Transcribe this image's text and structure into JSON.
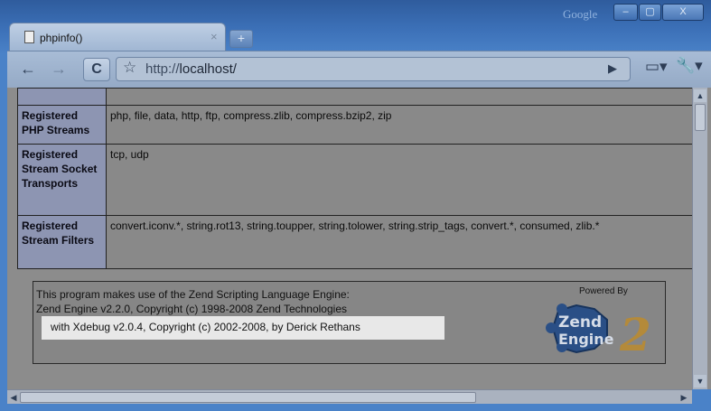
{
  "window": {
    "brand": "Google",
    "minimize_glyph": "‒",
    "maximize_glyph": "▢",
    "close_glyph": "X"
  },
  "tab": {
    "title": "phpinfo()",
    "close_glyph": "×",
    "new_tab_glyph": "+"
  },
  "toolbar": {
    "back_glyph": "←",
    "forward_glyph": "→",
    "reload_glyph": "C",
    "star_glyph": "☆",
    "url_scheme": "http://",
    "url_host": "localhost/",
    "go_glyph": "▶",
    "page_menu_glyph": "▭▾",
    "wrench_menu_glyph": "🔧▾"
  },
  "info_table": {
    "rows": [
      {
        "label": "",
        "value": ""
      },
      {
        "label": "Registered PHP Streams",
        "value": "php, file, data, http, ftp, compress.zlib, compress.bzip2, zip"
      },
      {
        "label": "Registered Stream Socket Transports",
        "value": "tcp, udp"
      },
      {
        "label": "Registered Stream Filters",
        "value": "convert.iconv.*, string.rot13, string.toupper, string.tolower, string.strip_tags, convert.*, consumed, zlib.*"
      }
    ]
  },
  "zend": {
    "line1": "This program makes use of the Zend Scripting Language Engine:",
    "line2": "Zend Engine v2.2.0, Copyright (c) 1998-2008 Zend Technologies",
    "xdebug": "with Xdebug v2.0.4, Copyright (c) 2002-2008, by Derick Rethans",
    "powered_by": "Powered By",
    "logo_word1": "Zend",
    "logo_word2": "Engine",
    "logo_number": "2"
  },
  "colors": {
    "frame_blue": "#3b6fb6",
    "table_label_bg": "#8d95b2",
    "table_value_bg": "#898989"
  },
  "icons": [
    "page-icon",
    "back-arrow-icon",
    "forward-arrow-icon",
    "reload-icon",
    "star-icon",
    "go-icon",
    "page-menu-icon",
    "wrench-icon"
  ]
}
